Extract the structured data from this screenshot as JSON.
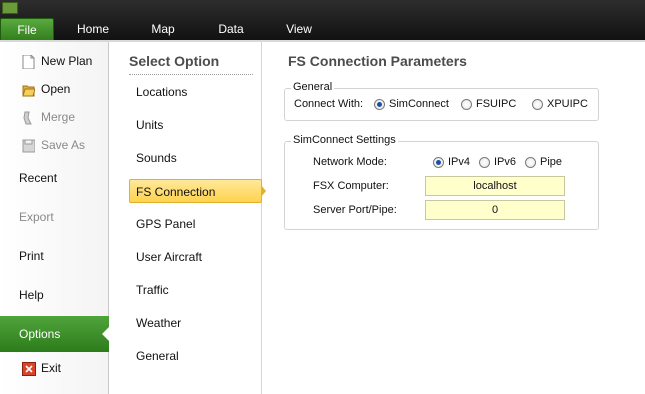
{
  "ribbon": {
    "tabs": [
      "File",
      "Home",
      "Map",
      "Data",
      "View"
    ]
  },
  "backstage": {
    "items": [
      {
        "label": "New Plan",
        "icon": "new-page-icon"
      },
      {
        "label": "Open",
        "icon": "folder-open-icon"
      },
      {
        "label": "Merge",
        "icon": "merge-icon"
      },
      {
        "label": "Save As",
        "icon": "floppy-disk-icon"
      },
      {
        "label": "Recent"
      },
      {
        "label": "Export"
      },
      {
        "label": "Print"
      },
      {
        "label": "Help"
      },
      {
        "label": "Options"
      },
      {
        "label": "Exit",
        "icon": "exit-icon"
      }
    ],
    "selected": "Options"
  },
  "options": {
    "heading": "Select Option",
    "items": [
      "Locations",
      "Units",
      "Sounds",
      "FS Connection",
      "GPS Panel",
      "User Aircraft",
      "Traffic",
      "Weather",
      "General"
    ],
    "selected": "FS Connection"
  },
  "content": {
    "title": "FS Connection Parameters",
    "general": {
      "legend": "General",
      "connect_label": "Connect With:",
      "options": [
        "SimConnect",
        "FSUIPC",
        "XPUIPC"
      ],
      "selected": "SimConnect"
    },
    "simconnect": {
      "legend": "SimConnect Settings",
      "network_label": "Network Mode:",
      "network_options": [
        "IPv4",
        "IPv6",
        "Pipe"
      ],
      "network_selected": "IPv4",
      "fsx_label": "FSX Computer:",
      "fsx_value": "localhost",
      "port_label": "Server Port/Pipe:",
      "port_value": "0"
    }
  },
  "colors": {
    "file_tab": "#3f8f2a",
    "selected_option": "#ffd34f",
    "field_bg": "#ffffcc"
  }
}
